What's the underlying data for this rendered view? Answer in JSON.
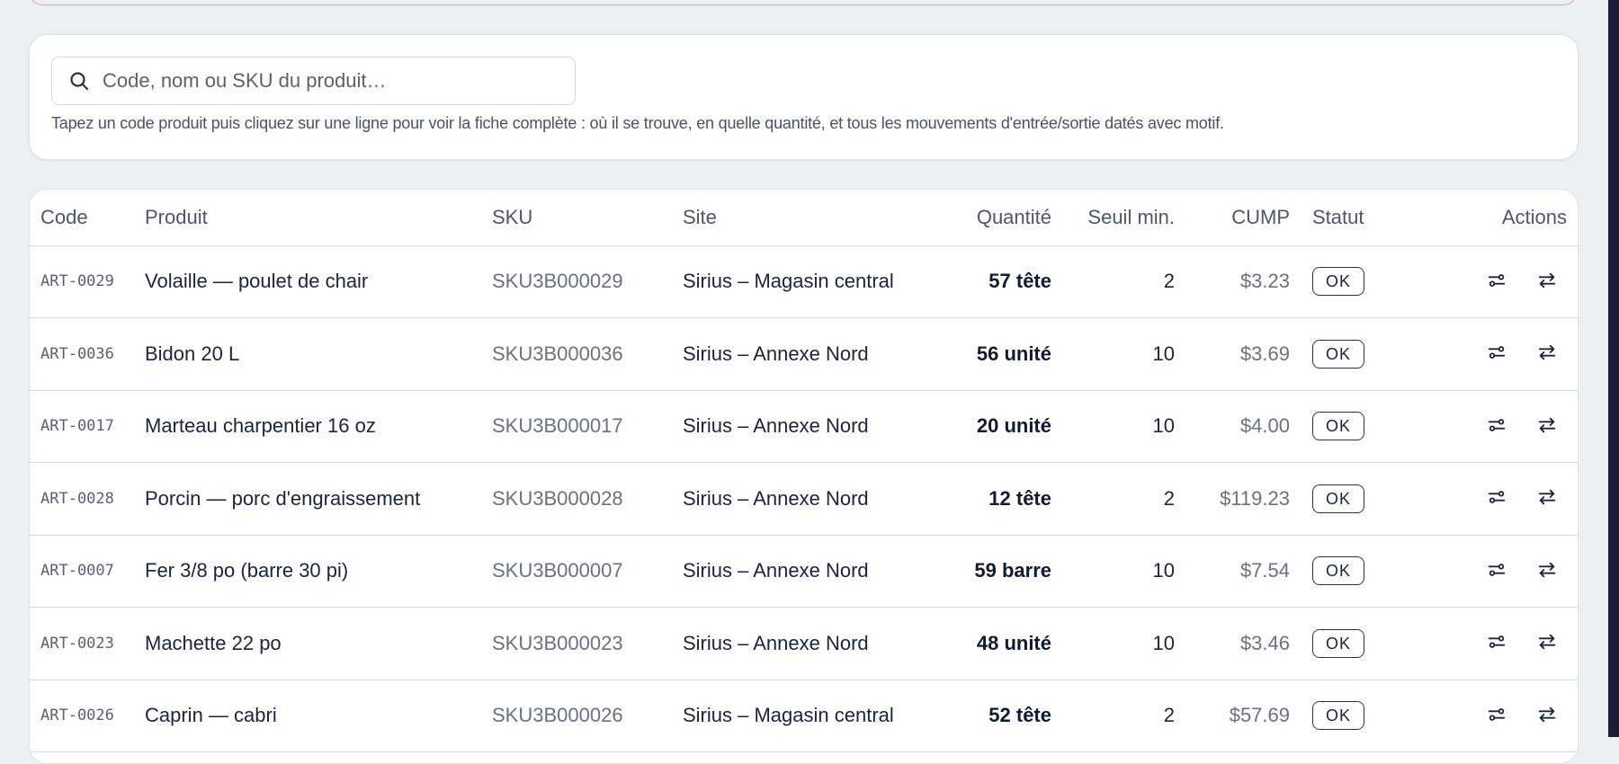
{
  "search": {
    "placeholder": "Code, nom ou SKU du produit…",
    "value": "",
    "hint": "Tapez un code produit puis cliquez sur une ligne pour voir la fiche complète : où il se trouve, en quelle quantité, et tous les mouvements d'entrée/sortie datés avec motif."
  },
  "table": {
    "headers": {
      "code": "Code",
      "product": "Produit",
      "sku": "SKU",
      "site": "Site",
      "quantity": "Quantité",
      "min_threshold": "Seuil min.",
      "cump": "CUMP",
      "status": "Statut",
      "actions": "Actions"
    },
    "rows": [
      {
        "code": "ART-0029",
        "product": "Volaille — poulet de chair",
        "sku": "SKU3B000029",
        "site": "Sirius – Magasin central",
        "quantity": "57 tête",
        "min": "2",
        "cump": "$3.23",
        "status": "OK"
      },
      {
        "code": "ART-0036",
        "product": "Bidon 20 L",
        "sku": "SKU3B000036",
        "site": "Sirius – Annexe Nord",
        "quantity": "56 unité",
        "min": "10",
        "cump": "$3.69",
        "status": "OK"
      },
      {
        "code": "ART-0017",
        "product": "Marteau charpentier 16 oz",
        "sku": "SKU3B000017",
        "site": "Sirius – Annexe Nord",
        "quantity": "20 unité",
        "min": "10",
        "cump": "$4.00",
        "status": "OK"
      },
      {
        "code": "ART-0028",
        "product": "Porcin — porc d'engraissement",
        "sku": "SKU3B000028",
        "site": "Sirius – Annexe Nord",
        "quantity": "12 tête",
        "min": "2",
        "cump": "$119.23",
        "status": "OK"
      },
      {
        "code": "ART-0007",
        "product": "Fer 3/8 po (barre 30 pi)",
        "sku": "SKU3B000007",
        "site": "Sirius – Annexe Nord",
        "quantity": "59 barre",
        "min": "10",
        "cump": "$7.54",
        "status": "OK"
      },
      {
        "code": "ART-0023",
        "product": "Machette 22 po",
        "sku": "SKU3B000023",
        "site": "Sirius – Annexe Nord",
        "quantity": "48 unité",
        "min": "10",
        "cump": "$3.46",
        "status": "OK"
      },
      {
        "code": "ART-0026",
        "product": "Caprin — cabri",
        "sku": "SKU3B000026",
        "site": "Sirius – Magasin central",
        "quantity": "52 tête",
        "min": "2",
        "cump": "$57.69",
        "status": "OK"
      }
    ]
  },
  "icons": {
    "search": "search-icon",
    "adjust": "adjust-stock-icon",
    "transfer": "transfer-icon"
  },
  "colors": {
    "background": "#edf0f3",
    "card": "#ffffff",
    "text_primary": "#1b2440",
    "text_muted": "#6a7184",
    "alert_border": "#e7a4ab",
    "rail": "#1b1f3a"
  }
}
